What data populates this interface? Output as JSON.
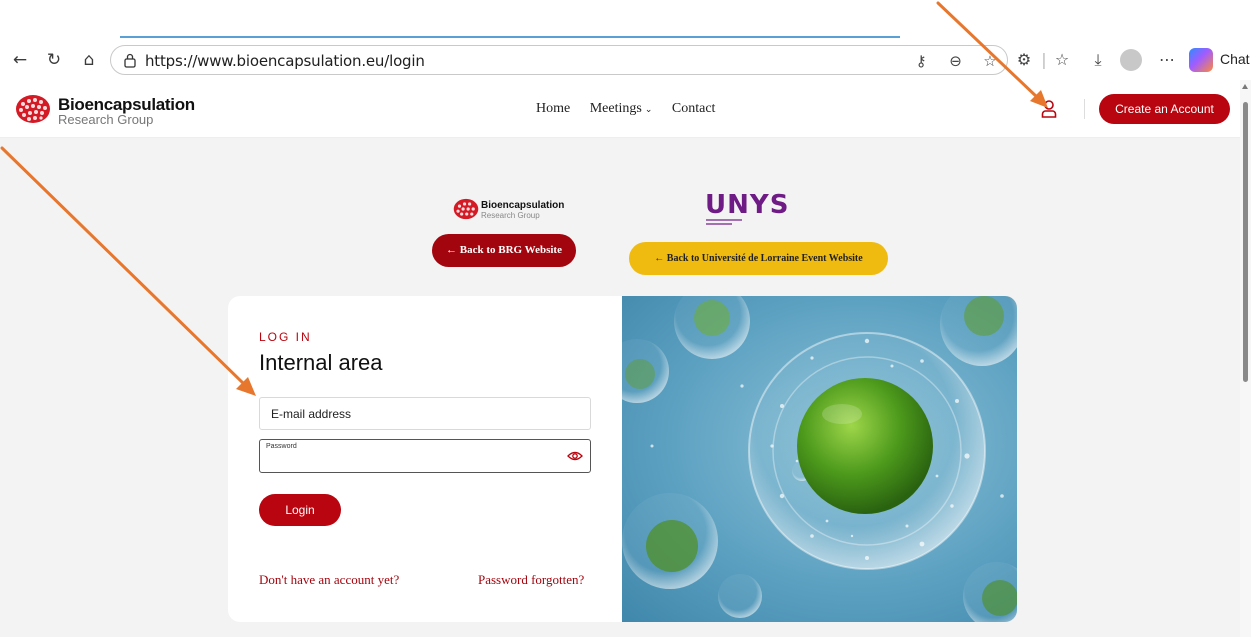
{
  "browser": {
    "url": "https://www.bioencapsulation.eu/login",
    "chat_label": "Chat"
  },
  "header": {
    "logo_main": "Bioencapsulation",
    "logo_sub": "Research Group",
    "nav": [
      "Home",
      "Meetings",
      "Contact"
    ],
    "create_account": "Create an Account"
  },
  "partners": {
    "brg_main": "Bioencapsulation",
    "brg_sub": "Research Group",
    "unys": "UNYS",
    "back_brg": "← Back to BRG Website",
    "back_unys": "← Back to Université de Lorraine Event Website"
  },
  "login": {
    "eyebrow": "LOG IN",
    "title": "Internal area",
    "email_placeholder": "E-mail address",
    "password_label": "Password",
    "login_button": "Login",
    "signup_link": "Don't have an account yet?",
    "forgot_link": "Password forgotten?"
  },
  "colors": {
    "brand_red": "#b8050f",
    "unys_purple": "#6e1b86",
    "unys_yellow": "#efbb11",
    "annotation_orange": "#e8772e"
  }
}
